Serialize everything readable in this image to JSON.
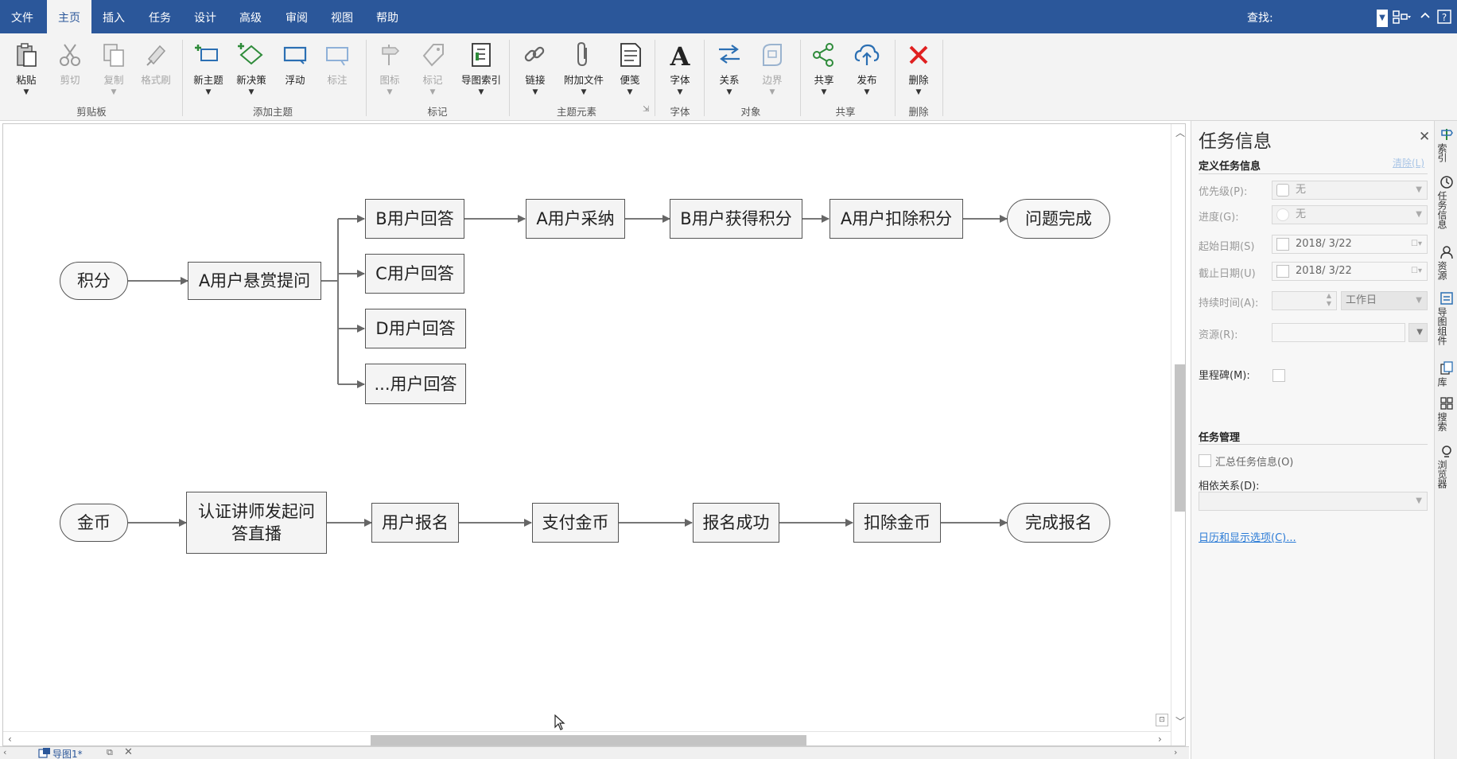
{
  "menu": {
    "items": [
      "文件",
      "主页",
      "插入",
      "任务",
      "设计",
      "高级",
      "审阅",
      "视图",
      "帮助"
    ],
    "active_index": 1,
    "search_label": "查找:"
  },
  "ribbon": {
    "buttons": {
      "paste": "粘贴",
      "cut": "剪切",
      "copy": "复制",
      "format_painter": "格式刷",
      "new_topic": "新主题",
      "new_decision": "新决策",
      "float": "浮动",
      "callout": "标注",
      "icon": "图标",
      "tag": "标记",
      "map_index": "导图索引",
      "link": "链接",
      "attach_file": "附加文件",
      "note": "便笺",
      "font": "字体",
      "relation": "关系",
      "boundary": "边界",
      "share": "共享",
      "publish": "发布",
      "delete": "删除"
    },
    "groups": {
      "clipboard": "剪贴板",
      "add_topic": "添加主题",
      "markers": "标记",
      "topic_elements": "主题元素",
      "font": "字体",
      "objects": "对象",
      "share": "共享",
      "delete": "删除"
    }
  },
  "diagram": {
    "points_flow": {
      "start": "积分",
      "ask": "A用户悬赏提问",
      "answers": [
        "B用户回答",
        "C用户回答",
        "D用户回答",
        "...用户回答"
      ],
      "steps": [
        "A用户采纳",
        "B用户获得积分",
        "A用户扣除积分"
      ],
      "end": "问题完成"
    },
    "coin_flow": {
      "start": "金币",
      "live": "认证讲师发起问答直播",
      "steps": [
        "用户报名",
        "支付金币",
        "报名成功",
        "扣除金币"
      ],
      "end": "完成报名"
    }
  },
  "doc_tab": {
    "label": "导图1*"
  },
  "task_panel": {
    "title": "任务信息",
    "define_section": "定义任务信息",
    "clear_link": "清除(L)",
    "priority_label": "优先级(P):",
    "priority_value": "无",
    "progress_label": "进度(G):",
    "progress_value": "无",
    "start_date_label": "起始日期(S)",
    "start_date_value": "2018/ 3/22",
    "due_date_label": "截止日期(U)",
    "due_date_value": "2018/ 3/22",
    "duration_label": "持续时间(A):",
    "duration_unit": "工作日",
    "resources_label": "资源(R):",
    "milestone_label": "里程碑(M):",
    "manage_section": "任务管理",
    "rollup_label": "汇总任务信息(O)",
    "dependency_label": "相依关系(D):",
    "calendar_link": "日历和显示选项(C)..."
  },
  "side_tabs": [
    "索引",
    "任务信息",
    "资源",
    "导图组件",
    "库",
    "搜索",
    "浏览器"
  ]
}
